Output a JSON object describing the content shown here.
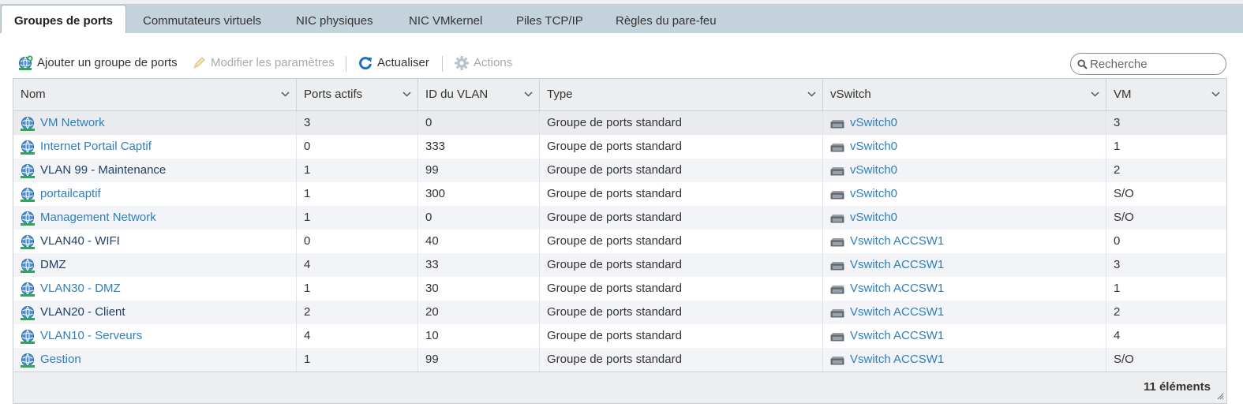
{
  "tabs": [
    {
      "label": "Groupes de ports",
      "active": true
    },
    {
      "label": "Commutateurs virtuels"
    },
    {
      "label": "NIC physiques"
    },
    {
      "label": "NIC VMkernel"
    },
    {
      "label": "Piles TCP/IP"
    },
    {
      "label": "Règles du pare-feu"
    }
  ],
  "toolbar": {
    "add_label": "Ajouter un groupe de ports",
    "edit_label": "Modifier les paramètres",
    "refresh_label": "Actualiser",
    "actions_label": "Actions"
  },
  "search": {
    "placeholder": "Recherche",
    "value": ""
  },
  "table": {
    "columns": [
      "Nom",
      "Ports actifs",
      "ID du VLAN",
      "Type",
      "vSwitch",
      "VM"
    ],
    "rows": [
      {
        "name": "VM Network",
        "ports": "3",
        "vlan": "0",
        "type": "Groupe de ports standard",
        "vswitch": "vSwitch0",
        "vm": "3"
      },
      {
        "name": "Internet Portail Captif",
        "ports": "0",
        "vlan": "333",
        "type": "Groupe de ports standard",
        "vswitch": "vSwitch0",
        "vm": "1"
      },
      {
        "name": "VLAN 99 - Maintenance",
        "ports": "1",
        "vlan": "99",
        "type": "Groupe de ports standard",
        "vswitch": "vSwitch0",
        "vm": "2"
      },
      {
        "name": "portailcaptif",
        "ports": "1",
        "vlan": "300",
        "type": "Groupe de ports standard",
        "vswitch": "vSwitch0",
        "vm": "S/O"
      },
      {
        "name": "Management Network",
        "ports": "1",
        "vlan": "0",
        "type": "Groupe de ports standard",
        "vswitch": "vSwitch0",
        "vm": "S/O"
      },
      {
        "name": "VLAN40 - WIFI",
        "ports": "0",
        "vlan": "40",
        "type": "Groupe de ports standard",
        "vswitch": "Vswitch ACCSW1",
        "vm": "0"
      },
      {
        "name": "DMZ",
        "ports": "4",
        "vlan": "33",
        "type": "Groupe de ports standard",
        "vswitch": "Vswitch ACCSW1",
        "vm": "3"
      },
      {
        "name": "VLAN30 - DMZ",
        "ports": "1",
        "vlan": "30",
        "type": "Groupe de ports standard",
        "vswitch": "Vswitch ACCSW1",
        "vm": "1"
      },
      {
        "name": "VLAN20 - Client",
        "ports": "2",
        "vlan": "20",
        "type": "Groupe de ports standard",
        "vswitch": "Vswitch ACCSW1",
        "vm": "2"
      },
      {
        "name": "VLAN10 - Serveurs",
        "ports": "4",
        "vlan": "10",
        "type": "Groupe de ports standard",
        "vswitch": "Vswitch ACCSW1",
        "vm": "4"
      },
      {
        "name": "Gestion",
        "ports": "1",
        "vlan": "99",
        "type": "Groupe de ports standard",
        "vswitch": "Vswitch ACCSW1",
        "vm": "S/O"
      }
    ]
  },
  "footer": {
    "count": "11 éléments"
  },
  "icons": {
    "row_icon": "network-globe-icon",
    "vswitch_icon": "switch-icon",
    "add_icon": "add-portgroup-icon",
    "edit_icon": "pencil-icon",
    "refresh_icon": "refresh-icon",
    "actions_icon": "gear-icon",
    "search_icon": "search-icon",
    "sort_icon": "chevron-down-icon"
  },
  "colors": {
    "link": "#2d7fbd",
    "tabbar": "#c4d2dc",
    "header": "#eceef0"
  }
}
